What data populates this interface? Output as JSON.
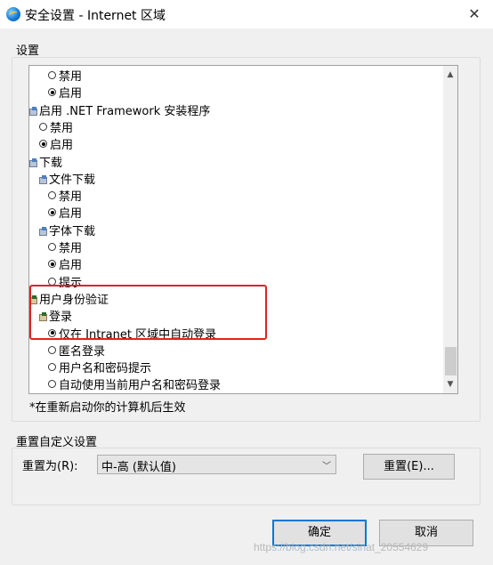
{
  "window": {
    "title": "安全设置 - Internet 区域",
    "icon": "ie-globe-icon",
    "close_glyph": "✕"
  },
  "settings_group": {
    "label": "设置"
  },
  "tree": [
    {
      "kind": "radio",
      "label": "禁用",
      "checked": false,
      "indent": 1
    },
    {
      "kind": "radio",
      "label": "启用",
      "checked": true,
      "indent": 1
    },
    {
      "kind": "group",
      "label": "启用 .NET Framework 安装程序",
      "icon": "settings-group-icon",
      "indent": 0
    },
    {
      "kind": "radio",
      "label": "禁用",
      "checked": false,
      "indent": 0
    },
    {
      "kind": "radio",
      "label": "启用",
      "checked": true,
      "indent": 0
    },
    {
      "kind": "group",
      "label": "下载",
      "icon": "settings-group-icon",
      "indent": 0
    },
    {
      "kind": "group",
      "label": "文件下载",
      "icon": "settings-group-icon",
      "indent": 1
    },
    {
      "kind": "radio",
      "label": "禁用",
      "checked": false,
      "indent": 1
    },
    {
      "kind": "radio",
      "label": "启用",
      "checked": true,
      "indent": 1
    },
    {
      "kind": "group",
      "label": "字体下载",
      "icon": "settings-group-icon",
      "indent": 1
    },
    {
      "kind": "radio",
      "label": "禁用",
      "checked": false,
      "indent": 1
    },
    {
      "kind": "radio",
      "label": "启用",
      "checked": true,
      "indent": 1
    },
    {
      "kind": "radio",
      "label": "提示",
      "checked": false,
      "indent": 1
    },
    {
      "kind": "group",
      "label": "用户身份验证",
      "icon": "user-auth-icon",
      "indent": 0
    },
    {
      "kind": "group",
      "label": "登录",
      "icon": "user-auth-icon",
      "indent": 1
    },
    {
      "kind": "radio",
      "label": "仅在 Intranet 区域中自动登录",
      "checked": true,
      "indent": 1
    },
    {
      "kind": "radio",
      "label": "匿名登录",
      "checked": false,
      "indent": 1
    },
    {
      "kind": "radio",
      "label": "用户名和密码提示",
      "checked": false,
      "indent": 1
    },
    {
      "kind": "radio",
      "label": "自动使用当前用户名和密码登录",
      "checked": false,
      "indent": 1
    }
  ],
  "note": "*在重新启动你的计算机后生效",
  "reset_group": {
    "label": "重置自定义设置",
    "reset_to_label": "重置为(R):",
    "level_value": "中-高 (默认值)",
    "reset_button": "重置(E)..."
  },
  "buttons": {
    "ok": "确定",
    "cancel": "取消"
  },
  "watermark": "https://blog.csdn.net/sinat_20554629",
  "colors": {
    "highlight": "#e0241b",
    "default_button_border": "#0078d7"
  }
}
